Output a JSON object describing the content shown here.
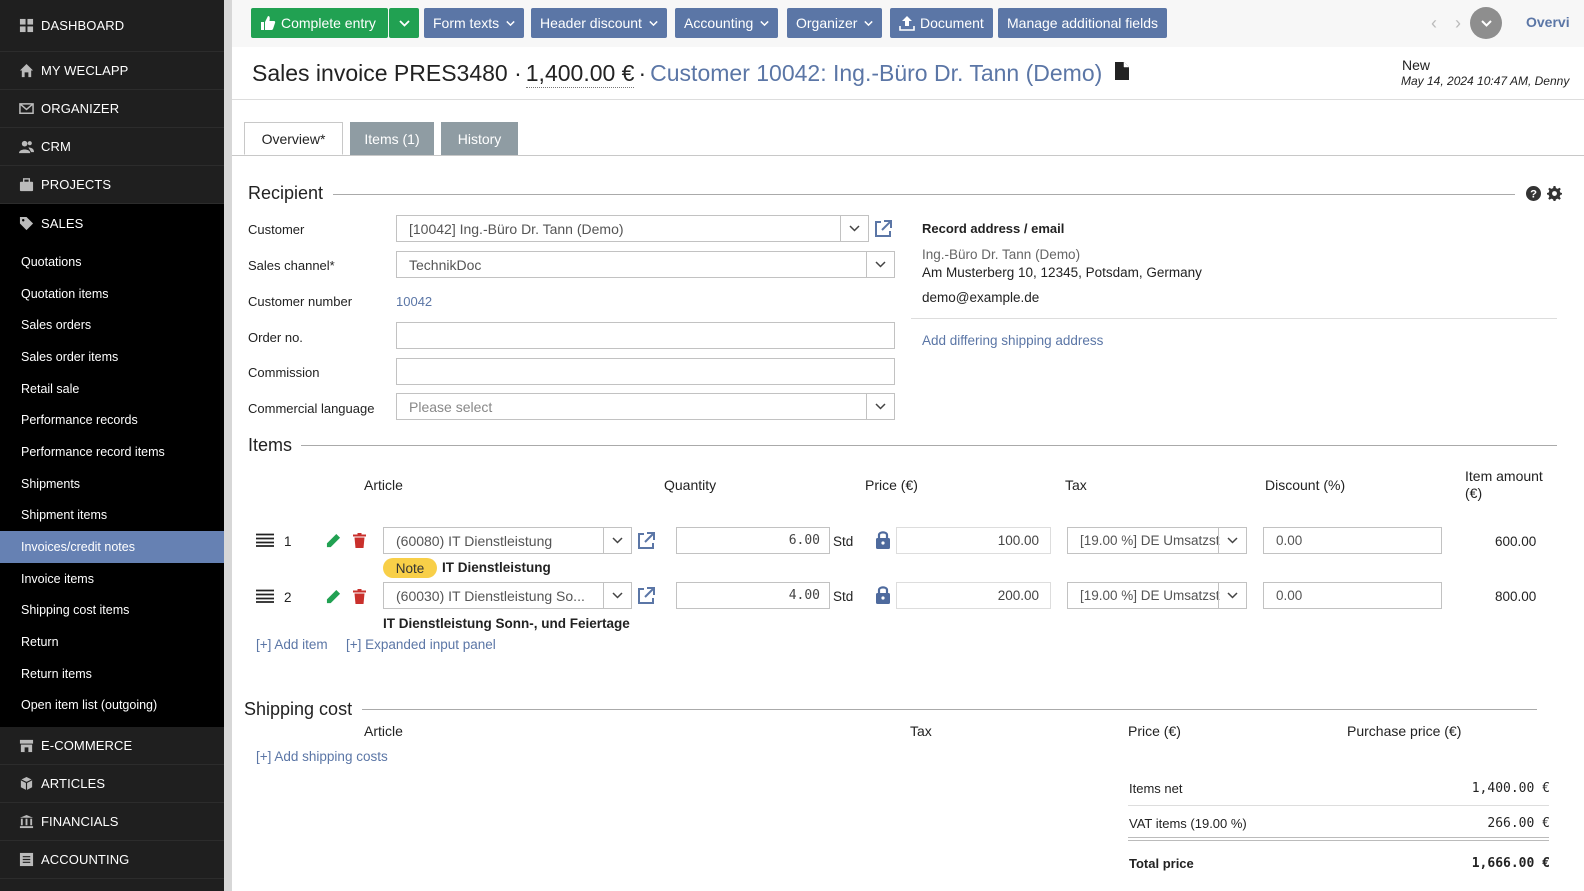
{
  "sidebar": {
    "dashboard": "DASHBOARD",
    "my_weclapp": "MY WECLAPP",
    "organizer": "ORGANIZER",
    "crm": "CRM",
    "projects": "PROJECTS",
    "sales": "SALES",
    "sales_items": [
      "Quotations",
      "Quotation items",
      "Sales orders",
      "Sales order items",
      "Retail sale",
      "Performance records",
      "Performance record items",
      "Shipments",
      "Shipment items",
      "Invoices/credit notes",
      "Invoice items",
      "Shipping cost items",
      "Return",
      "Return items",
      "Open item list (outgoing)"
    ],
    "active_item": "Invoices/credit notes",
    "e_commerce": "E-COMMERCE",
    "articles": "ARTICLES",
    "financials": "FINANCIALS",
    "accounting": "ACCOUNTING"
  },
  "toolbar": {
    "complete_entry": "Complete entry",
    "form_texts": "Form texts",
    "header_discount": "Header discount",
    "accounting": "Accounting",
    "organizer": "Organizer",
    "document": "Document",
    "manage_fields": "Manage additional fields",
    "overview": "Overvi"
  },
  "header": {
    "title": "Sales invoice PRES3480 ·",
    "amount": "1,400.00 €",
    "separator": "·",
    "customer": "Customer 10042: Ing.-Büro Dr. Tann (Demo)",
    "status": "New",
    "date": "May 14, 2024 10:47 AM, Denny"
  },
  "tabs": {
    "overview": "Overview*",
    "items": "Items (1)",
    "history": "History"
  },
  "recipient": {
    "heading": "Recipient",
    "customer_label": "Customer",
    "customer_value": "[10042] Ing.-Büro Dr. Tann (Demo)",
    "sales_channel_label": "Sales channel*",
    "sales_channel_value": "TechnikDoc",
    "customer_number_label": "Customer number",
    "customer_number_value": "10042",
    "order_no_label": "Order no.",
    "order_no_value": "",
    "commission_label": "Commission",
    "commission_value": "",
    "language_label": "Commercial language",
    "language_placeholder": "Please select",
    "record_address_heading": "Record address / email",
    "address_name": "Ing.-Büro Dr. Tann (Demo)",
    "address_line": "Am Musterberg 10, 12345, Potsdam, Germany",
    "email": "demo@example.de",
    "add_shipping_address": "Add differing shipping address"
  },
  "items": {
    "heading": "Items",
    "columns": {
      "article": "Article",
      "quantity": "Quantity",
      "price": "Price (€)",
      "tax": "Tax",
      "discount": "Discount (%)",
      "amount_line1": "Item amount",
      "amount_line2": "(€)"
    },
    "rows": [
      {
        "pos": "1",
        "article": "(60080) IT Dienstleistung",
        "quantity": "6.00",
        "unit": "Std",
        "price": "100.00",
        "tax": "[19.00 %] DE Umsatzst",
        "discount": "0.00",
        "amount": "600.00",
        "note_label": "Note",
        "description": "IT Dienstleistung"
      },
      {
        "pos": "2",
        "article": "(60030) IT Dienstleistung So...",
        "quantity": "4.00",
        "unit": "Std",
        "price": "200.00",
        "tax": "[19.00 %] DE Umsatzst",
        "discount": "0.00",
        "amount": "800.00",
        "description": "IT Dienstleistung Sonn-, und Feiertage"
      }
    ],
    "add_item": "[+] Add item",
    "expanded_panel": "[+] Expanded input panel"
  },
  "shipping": {
    "heading": "Shipping cost",
    "col_article": "Article",
    "col_tax": "Tax",
    "col_price": "Price (€)",
    "col_purchase": "Purchase price (€)",
    "add_costs": "[+] Add shipping costs"
  },
  "totals": {
    "items_net_label": "Items net",
    "items_net_value": "1,400.00 €",
    "vat_label": "VAT items (19.00 %)",
    "vat_value": "266.00 €",
    "total_label": "Total price",
    "total_value": "1,666.00 €"
  },
  "colors": {
    "sidebar_bg": "#1f1f1f",
    "active_item": "#6681b3",
    "button_blue": "#5b76a6",
    "button_green": "#21a152",
    "note_badge": "#f8cf48",
    "delete_red": "#c9302c"
  }
}
